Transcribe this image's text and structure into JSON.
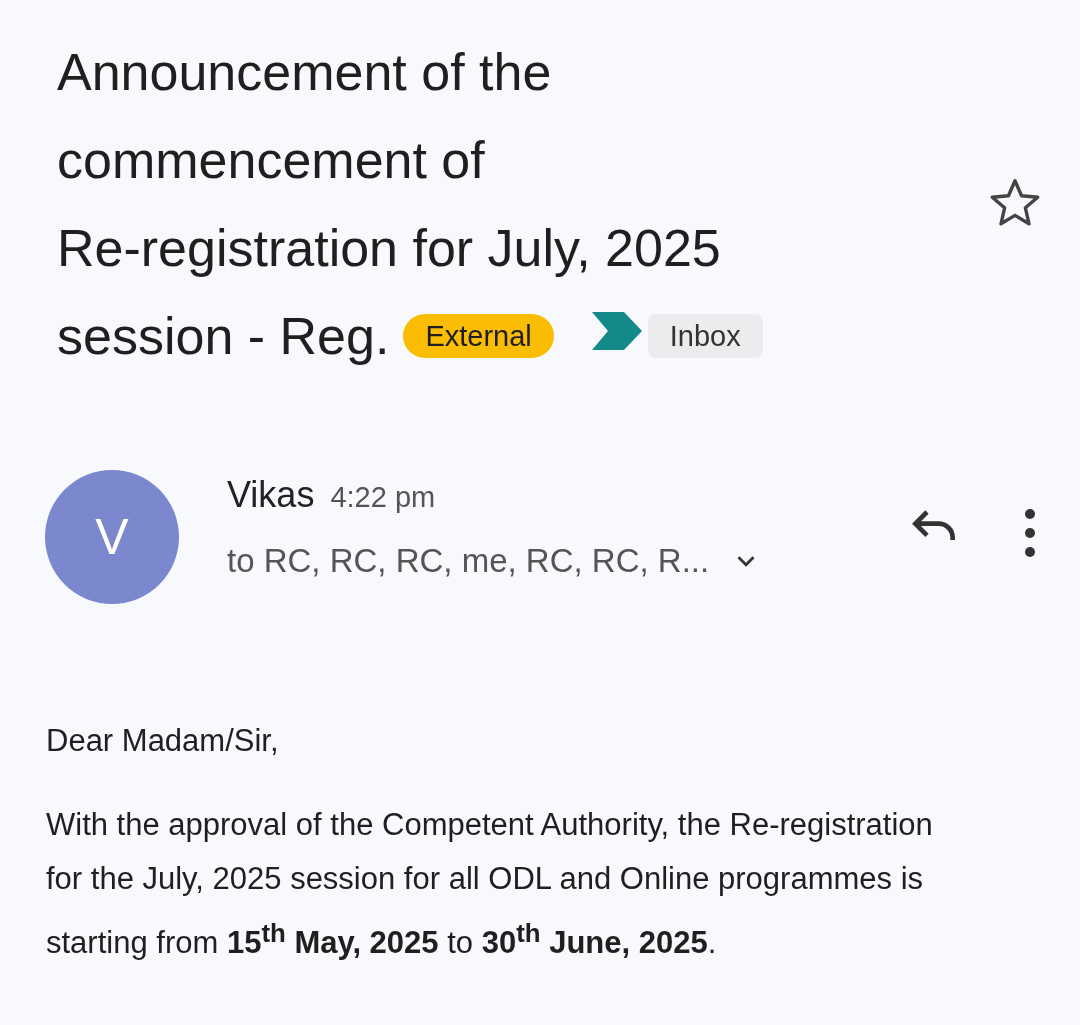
{
  "subject_lines": [
    "Announcement of the",
    "commencement of",
    "Re-registration for July, 2025",
    "session - Reg."
  ],
  "labels": [
    {
      "text": "External",
      "kind": "external",
      "important": false
    },
    {
      "text": "Inbox",
      "kind": "folder",
      "important": true
    }
  ],
  "starred": false,
  "sender": {
    "initial": "V",
    "name": "Vikas",
    "time": "4:22 pm",
    "recipients": "to RC, RC, RC, me, RC, RC, R..."
  },
  "body": [
    "Dear Madam/Sir,",
    "With the approval of the Competent Authority, the Re-registration for the July, 2025 session for all ODL and Online programmes is starting from  **15$^{th}$ May, 2025** to **30$^{th}$ June, 2025**."
  ]
}
